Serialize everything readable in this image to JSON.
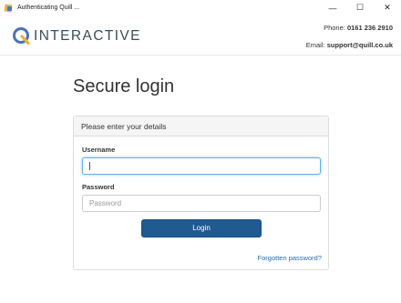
{
  "window": {
    "title": "Authenticating Quill ...",
    "controls": {
      "minimize": "—",
      "maximize": "☐",
      "close": "✕"
    }
  },
  "header": {
    "brand": "INTERACTIVE",
    "phone_label": "Phone:",
    "phone_value": "0161 236 2910",
    "email_label": "Email:",
    "email_value": "support@quill.co.uk"
  },
  "page": {
    "title": "Secure login"
  },
  "panel": {
    "heading": "Please enter your details",
    "username_label": "Username",
    "username_value": "",
    "password_label": "Password",
    "password_placeholder": "Password",
    "login_label": "Login",
    "forgot_label": "Forgotten password?"
  },
  "icons": {
    "logo": "quill-q-logo-icon",
    "app": "app-icon"
  },
  "colors": {
    "brand_text": "#3b4d5e",
    "logo_blue": "#4a72b8",
    "logo_yellow": "#e9b33c",
    "button": "#1f5a91",
    "link": "#2a6bb5",
    "focus": "#66afe9"
  }
}
